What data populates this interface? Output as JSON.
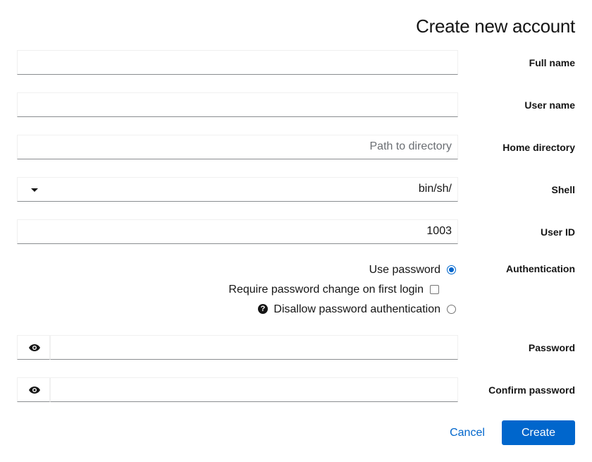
{
  "dialog": {
    "title": "Create new account"
  },
  "fields": {
    "full_name": {
      "label": "Full name",
      "value": ""
    },
    "user_name": {
      "label": "User name",
      "value": ""
    },
    "home_directory": {
      "label": "Home directory",
      "value": "",
      "placeholder": "Path to directory"
    },
    "shell": {
      "label": "Shell",
      "value": "bin/sh/"
    },
    "user_id": {
      "label": "User ID",
      "value": "1003"
    },
    "password": {
      "label": "Password",
      "value": ""
    },
    "confirm_password": {
      "label": "Confirm password",
      "value": ""
    }
  },
  "authentication": {
    "label": "Authentication",
    "use_password": {
      "label": "Use password",
      "selected": true
    },
    "require_change": {
      "label": "Require password change on first login",
      "checked": false
    },
    "disallow_password": {
      "label": "Disallow password authentication",
      "selected": false
    }
  },
  "icons": {
    "help": "?",
    "caret": "caret-down-icon",
    "eye": "eye-icon"
  },
  "actions": {
    "cancel_label": "Cancel",
    "create_label": "Create"
  },
  "colors": {
    "primary": "#0066cc",
    "text": "#151515",
    "placeholder": "#6a6e73",
    "border": "#8a8d90"
  }
}
